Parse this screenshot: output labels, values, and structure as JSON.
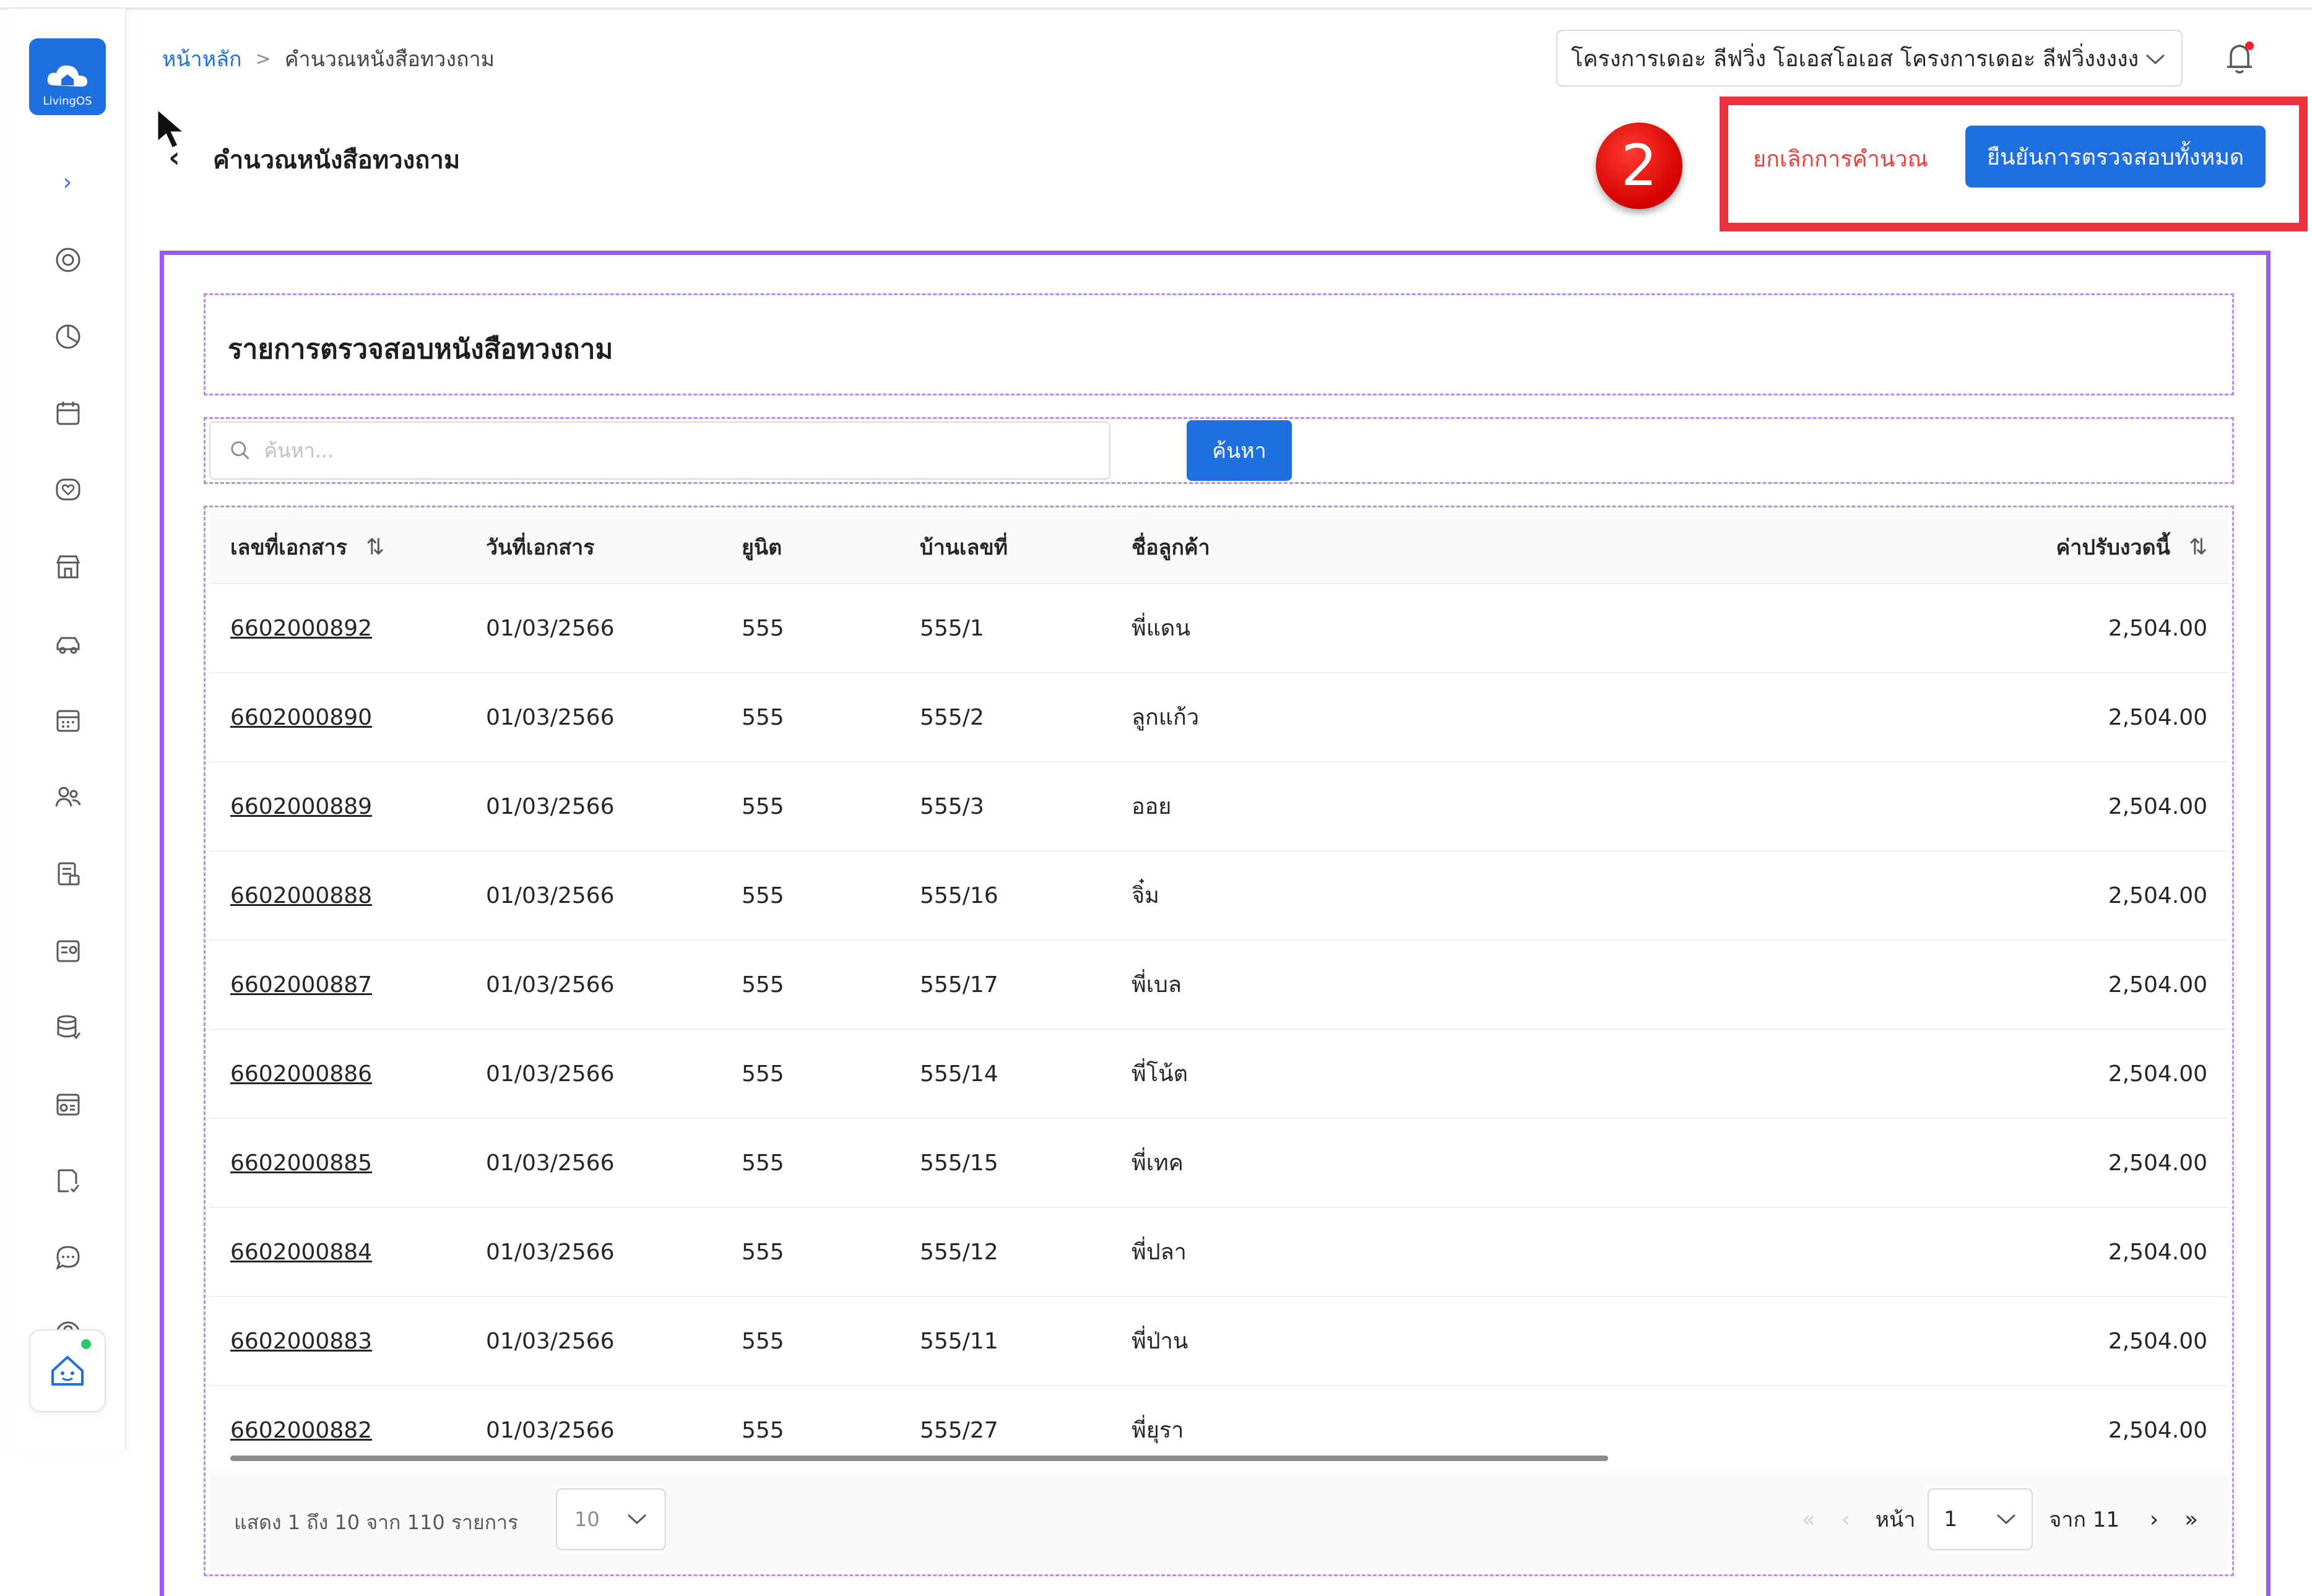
{
  "app": {
    "logo_text": "LivingOS"
  },
  "breadcrumb": {
    "home": "หน้าหลัก",
    "separator": ">",
    "current": "คำนวณหนังสือทวงถาม"
  },
  "project_select": {
    "value": "โครงการเดอะ ลีฟวิ่ง โอเอสโอเอส โครงการเดอะ ลีฟวิ่งงงงง"
  },
  "header": {
    "title": "คำนวณหนังสือทวงถาม",
    "step_number": "2",
    "cancel_label": "ยกเลิกการคำนวณ",
    "confirm_label": "ยืนยันการตรวจสอบทั้งหมด"
  },
  "sidebar": {
    "expand_icon": "chevron-right-icon",
    "icons": [
      "target-icon",
      "pie-chart-icon",
      "calendar-box-icon",
      "heart-chat-icon",
      "store-icon",
      "car-icon",
      "calendar-icon",
      "people-icon",
      "invoice-icon",
      "id-card-icon",
      "database-icon",
      "payment-icon",
      "document-check-icon",
      "chat-icon",
      "help-icon"
    ]
  },
  "section": {
    "title": "รายการตรวจสอบหนังสือทวงถาม"
  },
  "search": {
    "placeholder": "ค้นหา...",
    "value": "",
    "button_label": "ค้นหา"
  },
  "table": {
    "columns": {
      "doc_no": "เลขที่เอกสาร",
      "doc_date": "วันที่เอกสาร",
      "unit": "ยูนิต",
      "house_no": "บ้านเลขที่",
      "customer": "ชื่อลูกค้า",
      "fine": "ค่าปรับงวดนี้"
    },
    "rows": [
      {
        "doc_no": "6602000892",
        "doc_date": "01/03/2566",
        "unit": "555",
        "house_no": "555/1",
        "customer": "พี่แดน",
        "fine": "2,504.00"
      },
      {
        "doc_no": "6602000890",
        "doc_date": "01/03/2566",
        "unit": "555",
        "house_no": "555/2",
        "customer": "ลูกแก้ว",
        "fine": "2,504.00"
      },
      {
        "doc_no": "6602000889",
        "doc_date": "01/03/2566",
        "unit": "555",
        "house_no": "555/3",
        "customer": "ออย",
        "fine": "2,504.00"
      },
      {
        "doc_no": "6602000888",
        "doc_date": "01/03/2566",
        "unit": "555",
        "house_no": "555/16",
        "customer": "จิ๋ม",
        "fine": "2,504.00"
      },
      {
        "doc_no": "6602000887",
        "doc_date": "01/03/2566",
        "unit": "555",
        "house_no": "555/17",
        "customer": "พี่เบล",
        "fine": "2,504.00"
      },
      {
        "doc_no": "6602000886",
        "doc_date": "01/03/2566",
        "unit": "555",
        "house_no": "555/14",
        "customer": "พี่โน้ต",
        "fine": "2,504.00"
      },
      {
        "doc_no": "6602000885",
        "doc_date": "01/03/2566",
        "unit": "555",
        "house_no": "555/15",
        "customer": "พี่เทค",
        "fine": "2,504.00"
      },
      {
        "doc_no": "6602000884",
        "doc_date": "01/03/2566",
        "unit": "555",
        "house_no": "555/12",
        "customer": "พี่ปลา",
        "fine": "2,504.00"
      },
      {
        "doc_no": "6602000883",
        "doc_date": "01/03/2566",
        "unit": "555",
        "house_no": "555/11",
        "customer": "พี่ป่าน",
        "fine": "2,504.00"
      },
      {
        "doc_no": "6602000882",
        "doc_date": "01/03/2566",
        "unit": "555",
        "house_no": "555/27",
        "customer": "พี่ยุรา",
        "fine": "2,504.00"
      }
    ]
  },
  "pagination": {
    "summary": "แสดง 1 ถึง 10 จาก 110 รายการ",
    "page_size": "10",
    "page_label": "หน้า",
    "current_page": "1",
    "of_label": "จาก",
    "total_pages": "11",
    "first": "«",
    "prev": "‹",
    "next": "›",
    "last": "»"
  },
  "colors": {
    "primary": "#1e6fe0",
    "danger": "#ee3b3b",
    "frame": "#9b59f5",
    "highlight": "#e9343f",
    "badge": "#e10000"
  }
}
